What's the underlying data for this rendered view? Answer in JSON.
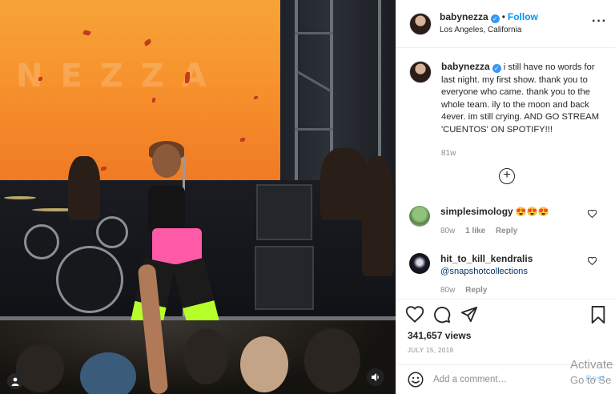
{
  "post": {
    "media": {
      "stage_screen_text": "NEZZA",
      "user_tag_icon": "person-icon",
      "sound_icon": "speaker-icon"
    },
    "header": {
      "username": "babynezza",
      "verified_icon": "verified-badge-icon",
      "separator": "•",
      "follow_label": "Follow",
      "location": "Los Angeles, California",
      "more_icon": "more-options-icon",
      "more_glyph": "···"
    },
    "caption": {
      "username": "babynezza",
      "text": "i still have no words for last night. my first show. thank you to everyone who came. thank you to the whole team. ily to the moon and back 4ever. im still crying. AND GO STREAM 'CUENTOS' ON SPOTIFY!!!",
      "time": "81w"
    },
    "load_more_icon": "plus-circle-icon",
    "load_more_glyph": "+",
    "comments": [
      {
        "username": "simplesimology",
        "text": "😍😍😍",
        "time": "80w",
        "likes": "1 like",
        "reply": "Reply"
      },
      {
        "username": "hit_to_kill_kendralis",
        "text": "@snapshotcollections",
        "time": "80w",
        "reply": "Reply"
      }
    ],
    "actions": {
      "like_icon": "heart-icon",
      "comment_icon": "comment-icon",
      "share_icon": "share-icon",
      "save_icon": "bookmark-icon",
      "views": "341,657 views",
      "date": "JULY 15, 2019"
    },
    "add_comment": {
      "emoji_icon": "smiley-icon",
      "placeholder": "Add a comment…",
      "post_label": "Post"
    }
  },
  "watermark": {
    "line1": "Activate",
    "line2": "Go to Se"
  }
}
